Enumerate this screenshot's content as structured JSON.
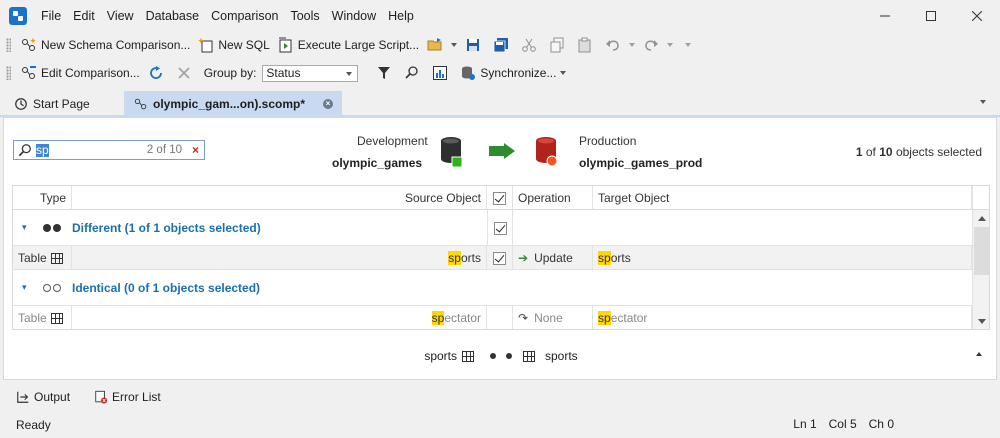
{
  "menu": [
    "File",
    "Edit",
    "View",
    "Database",
    "Comparison",
    "Tools",
    "Window",
    "Help"
  ],
  "toolbar1": {
    "new_schema_comparison": "New Schema Comparison...",
    "new_sql": "New SQL",
    "execute_large_script": "Execute Large Script..."
  },
  "toolbar2": {
    "edit_comparison": "Edit Comparison...",
    "group_by_label": "Group by:",
    "group_by_value": "Status",
    "synchronize": "Synchronize..."
  },
  "tabs": {
    "start_page": "Start Page",
    "active": "olympic_gam...on).scomp*"
  },
  "search": {
    "value": "sp",
    "count": "2 of 10"
  },
  "source": {
    "label": "Development",
    "db": "olympic_games"
  },
  "target": {
    "label": "Production",
    "db": "olympic_games_prod"
  },
  "selection": {
    "selected": "1",
    "of": "of",
    "total": "10",
    "suffix": "objects selected"
  },
  "grid": {
    "headers": {
      "type": "Type",
      "source_object": "Source Object",
      "operation": "Operation",
      "target_object": "Target Object"
    },
    "groups": [
      {
        "title": "Different (1 of 1 objects selected)",
        "rows": [
          {
            "type": "Table",
            "source_hl": "sp",
            "source_rest": "orts",
            "operation": "Update",
            "target_hl": "sp",
            "target_rest": "orts"
          }
        ]
      },
      {
        "title": "Identical (0 of 1 objects selected)",
        "rows": [
          {
            "type": "Table",
            "source_hl": "sp",
            "source_rest": "ectator",
            "operation": "None",
            "target_hl": "sp",
            "target_rest": "ectator"
          }
        ]
      }
    ]
  },
  "summary": {
    "source": "sports",
    "target": "sports"
  },
  "bottom_tabs": {
    "output": "Output",
    "error_list": "Error List"
  },
  "status": {
    "text": "Ready",
    "ln": "Ln 1",
    "col": "Col 5",
    "ch": "Ch 0"
  },
  "colors": {
    "accent": "#1a6fb3",
    "highlight": "#ffd800",
    "tab_active": "#c9daf0"
  }
}
